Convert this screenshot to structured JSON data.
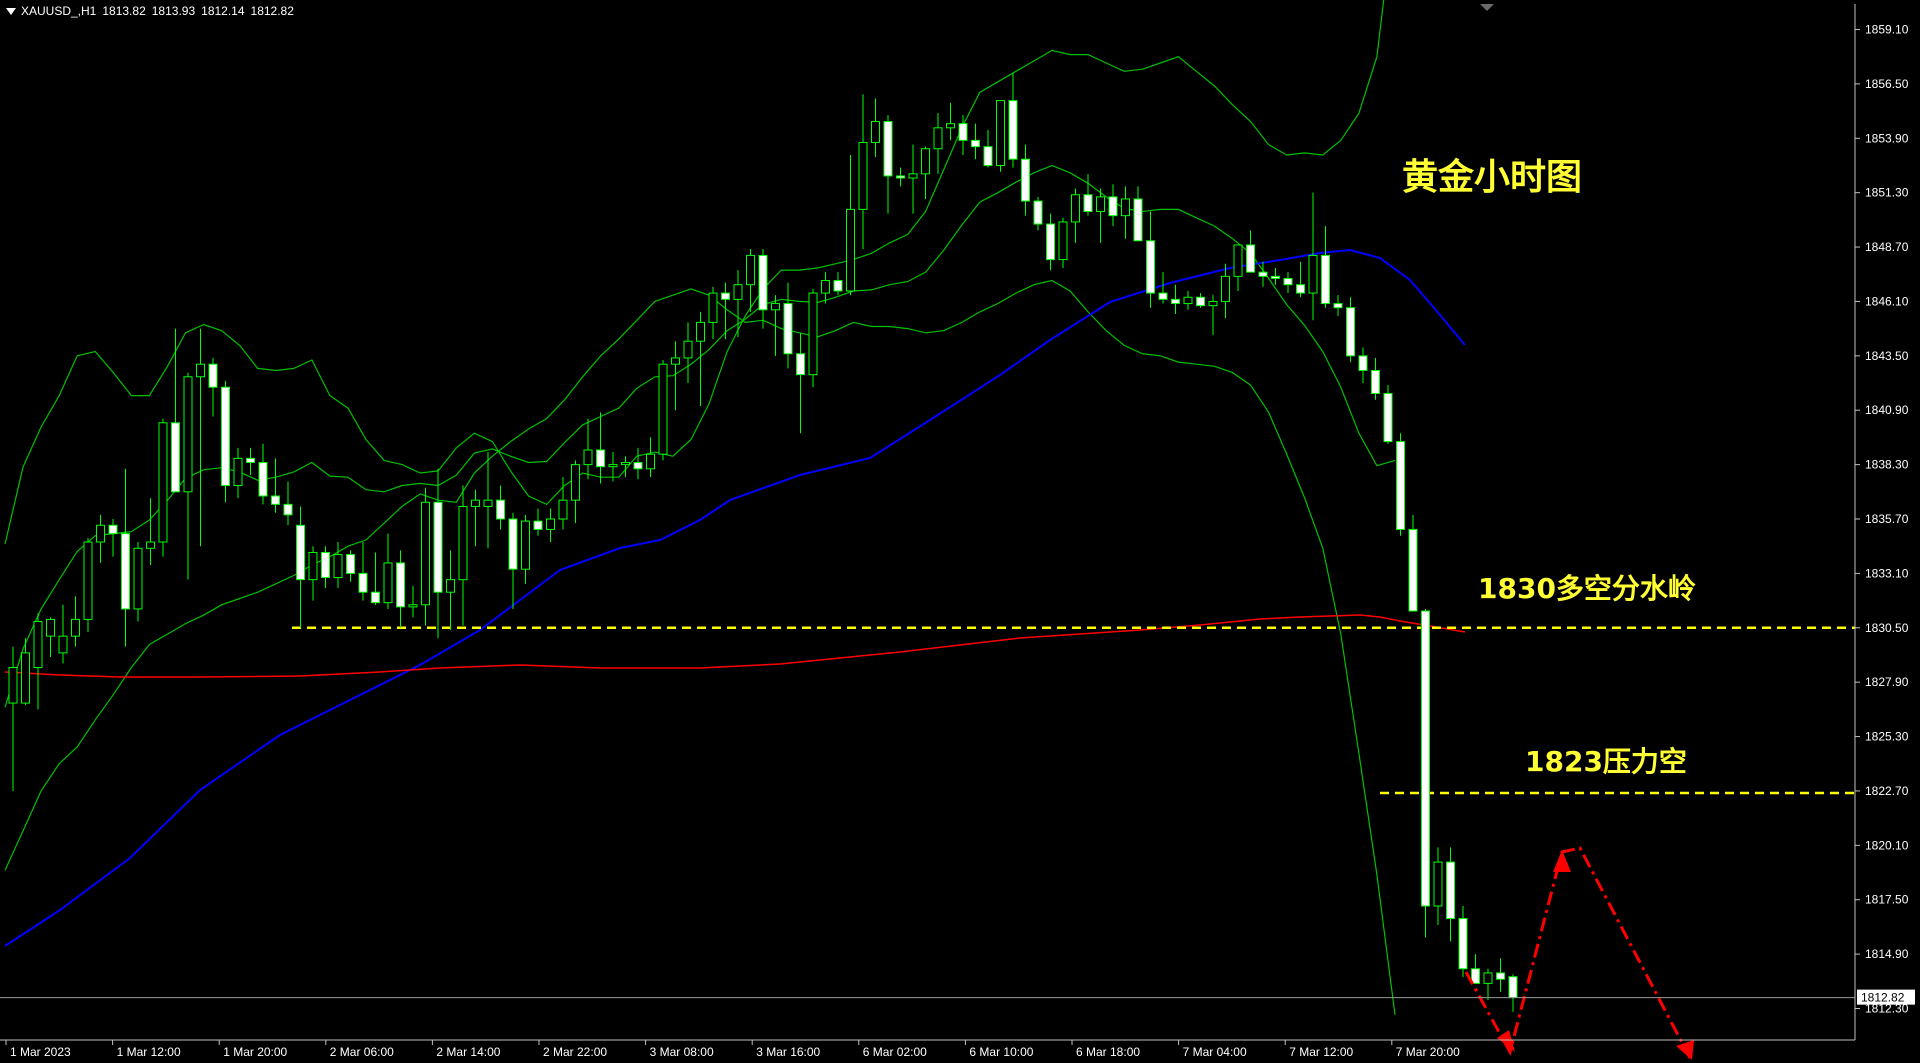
{
  "header": {
    "symbol": "XAUUSD_,H1",
    "open": "1813.82",
    "high": "1813.93",
    "low": "1812.14",
    "close": "1812.82"
  },
  "annotations": {
    "title": "黄金小时图",
    "level_1830_label": "1830多空分水岭",
    "level_1823_label": "1823压力空"
  },
  "colors": {
    "background": "#000000",
    "axis": "#c0c0c0",
    "candle_up": "#000000",
    "candle_down": "#ffffff",
    "wick": "#00ff00",
    "bollinger": "#00c000",
    "ma_blue": "#0000ff",
    "ma_red": "#ff0000",
    "level_line": "#ffff00",
    "projection": "#ff0000"
  },
  "chart_data": {
    "type": "candlestick",
    "price_axis": {
      "ylim": [
        1811.1,
        1860.3
      ],
      "ticks": [
        "1859.10",
        "1856.50",
        "1853.90",
        "1851.30",
        "1848.70",
        "1846.10",
        "1843.50",
        "1840.90",
        "1838.30",
        "1835.70",
        "1833.10",
        "1830.50",
        "1827.90",
        "1825.30",
        "1822.70",
        "1820.10",
        "1817.50",
        "1814.90",
        "1812.30"
      ],
      "current_price": "1812.82"
    },
    "time_axis": {
      "ticks": [
        "1 Mar 2023",
        "1 Mar 12:00",
        "1 Mar 20:00",
        "2 Mar 06:00",
        "2 Mar 14:00",
        "2 Mar 22:00",
        "3 Mar 08:00",
        "3 Mar 16:00",
        "6 Mar 02:00",
        "6 Mar 10:00",
        "6 Mar 18:00",
        "7 Mar 04:00",
        "7 Mar 12:00",
        "7 Mar 20:00"
      ]
    },
    "candles": [
      {
        "o": 1826.9,
        "h": 1829.6,
        "l": 1822.7,
        "c": 1828.6
      },
      {
        "o": 1826.9,
        "h": 1830.0,
        "l": 1826.8,
        "c": 1829.3
      },
      {
        "o": 1828.6,
        "h": 1831.2,
        "l": 1826.6,
        "c": 1830.8
      },
      {
        "o": 1830.1,
        "h": 1831.0,
        "l": 1829.1,
        "c": 1830.9
      },
      {
        "o": 1829.3,
        "h": 1831.6,
        "l": 1828.8,
        "c": 1830.1
      },
      {
        "o": 1830.1,
        "h": 1832.0,
        "l": 1829.6,
        "c": 1830.9
      },
      {
        "o": 1830.9,
        "h": 1834.8,
        "l": 1830.3,
        "c": 1834.6
      },
      {
        "o": 1834.6,
        "h": 1835.9,
        "l": 1833.6,
        "c": 1835.4
      },
      {
        "o": 1835.4,
        "h": 1835.7,
        "l": 1833.9,
        "c": 1835.0
      },
      {
        "o": 1835.0,
        "h": 1838.1,
        "l": 1829.6,
        "c": 1831.4
      },
      {
        "o": 1831.4,
        "h": 1834.6,
        "l": 1830.8,
        "c": 1834.3
      },
      {
        "o": 1834.3,
        "h": 1836.7,
        "l": 1833.5,
        "c": 1834.6
      },
      {
        "o": 1834.6,
        "h": 1840.5,
        "l": 1833.9,
        "c": 1840.3
      },
      {
        "o": 1840.3,
        "h": 1844.8,
        "l": 1840.0,
        "c": 1837.0
      },
      {
        "o": 1837.0,
        "h": 1842.7,
        "l": 1832.8,
        "c": 1842.5
      },
      {
        "o": 1842.5,
        "h": 1844.8,
        "l": 1834.4,
        "c": 1843.1
      },
      {
        "o": 1843.1,
        "h": 1843.4,
        "l": 1840.6,
        "c": 1842.0
      },
      {
        "o": 1842.0,
        "h": 1842.3,
        "l": 1836.5,
        "c": 1837.3
      },
      {
        "o": 1837.3,
        "h": 1839.1,
        "l": 1836.7,
        "c": 1838.6
      },
      {
        "o": 1838.6,
        "h": 1839.1,
        "l": 1837.8,
        "c": 1838.4
      },
      {
        "o": 1838.4,
        "h": 1839.3,
        "l": 1836.4,
        "c": 1836.8
      },
      {
        "o": 1836.8,
        "h": 1838.6,
        "l": 1836.0,
        "c": 1836.4
      },
      {
        "o": 1836.4,
        "h": 1837.5,
        "l": 1835.4,
        "c": 1835.9
      },
      {
        "o": 1835.4,
        "h": 1836.3,
        "l": 1830.5,
        "c": 1832.8
      },
      {
        "o": 1832.8,
        "h": 1834.4,
        "l": 1831.8,
        "c": 1834.1
      },
      {
        "o": 1834.1,
        "h": 1834.4,
        "l": 1832.4,
        "c": 1832.9
      },
      {
        "o": 1832.9,
        "h": 1834.6,
        "l": 1832.4,
        "c": 1834.0
      },
      {
        "o": 1834.0,
        "h": 1834.2,
        "l": 1832.7,
        "c": 1833.1
      },
      {
        "o": 1833.1,
        "h": 1834.6,
        "l": 1831.8,
        "c": 1832.2
      },
      {
        "o": 1832.2,
        "h": 1834.1,
        "l": 1831.6,
        "c": 1831.7
      },
      {
        "o": 1831.7,
        "h": 1835.0,
        "l": 1831.4,
        "c": 1833.6
      },
      {
        "o": 1833.6,
        "h": 1834.2,
        "l": 1830.5,
        "c": 1831.5
      },
      {
        "o": 1831.5,
        "h": 1832.5,
        "l": 1831.0,
        "c": 1831.6
      },
      {
        "o": 1831.6,
        "h": 1837.2,
        "l": 1830.6,
        "c": 1836.5
      },
      {
        "o": 1836.5,
        "h": 1838.1,
        "l": 1830.0,
        "c": 1832.2
      },
      {
        "o": 1832.2,
        "h": 1834.2,
        "l": 1830.4,
        "c": 1832.8
      },
      {
        "o": 1832.8,
        "h": 1837.3,
        "l": 1830.6,
        "c": 1836.3
      },
      {
        "o": 1836.3,
        "h": 1837.1,
        "l": 1834.4,
        "c": 1836.6
      },
      {
        "o": 1836.3,
        "h": 1838.9,
        "l": 1834.3,
        "c": 1836.6
      },
      {
        "o": 1836.6,
        "h": 1837.3,
        "l": 1835.2,
        "c": 1835.7
      },
      {
        "o": 1835.7,
        "h": 1836.0,
        "l": 1831.4,
        "c": 1833.3
      },
      {
        "o": 1833.3,
        "h": 1835.9,
        "l": 1832.6,
        "c": 1835.6
      },
      {
        "o": 1835.6,
        "h": 1836.2,
        "l": 1834.9,
        "c": 1835.2
      },
      {
        "o": 1835.2,
        "h": 1836.2,
        "l": 1834.6,
        "c": 1835.7
      },
      {
        "o": 1835.7,
        "h": 1837.7,
        "l": 1835.2,
        "c": 1836.6
      },
      {
        "o": 1836.6,
        "h": 1838.5,
        "l": 1835.5,
        "c": 1838.3
      },
      {
        "o": 1838.3,
        "h": 1840.5,
        "l": 1837.6,
        "c": 1839.0
      },
      {
        "o": 1839.0,
        "h": 1840.8,
        "l": 1837.4,
        "c": 1838.2
      },
      {
        "o": 1838.2,
        "h": 1838.9,
        "l": 1837.5,
        "c": 1838.3
      },
      {
        "o": 1838.3,
        "h": 1838.7,
        "l": 1837.7,
        "c": 1838.4
      },
      {
        "o": 1838.4,
        "h": 1839.1,
        "l": 1837.6,
        "c": 1838.1
      },
      {
        "o": 1838.1,
        "h": 1839.6,
        "l": 1837.7,
        "c": 1838.8
      },
      {
        "o": 1838.8,
        "h": 1843.3,
        "l": 1838.5,
        "c": 1843.1
      },
      {
        "o": 1843.1,
        "h": 1844.2,
        "l": 1840.9,
        "c": 1843.4
      },
      {
        "o": 1843.4,
        "h": 1845.1,
        "l": 1842.2,
        "c": 1844.2
      },
      {
        "o": 1844.2,
        "h": 1845.6,
        "l": 1841.1,
        "c": 1845.1
      },
      {
        "o": 1845.1,
        "h": 1846.8,
        "l": 1844.3,
        "c": 1846.5
      },
      {
        "o": 1846.5,
        "h": 1847.0,
        "l": 1844.3,
        "c": 1846.2
      },
      {
        "o": 1846.2,
        "h": 1847.6,
        "l": 1844.4,
        "c": 1846.9
      },
      {
        "o": 1846.9,
        "h": 1848.6,
        "l": 1845.6,
        "c": 1848.3
      },
      {
        "o": 1848.3,
        "h": 1848.6,
        "l": 1844.8,
        "c": 1845.7
      },
      {
        "o": 1845.7,
        "h": 1846.4,
        "l": 1843.5,
        "c": 1846.0
      },
      {
        "o": 1846.0,
        "h": 1847.0,
        "l": 1842.9,
        "c": 1843.6
      },
      {
        "o": 1843.6,
        "h": 1844.6,
        "l": 1839.8,
        "c": 1842.6
      },
      {
        "o": 1842.6,
        "h": 1846.7,
        "l": 1842.0,
        "c": 1846.5
      },
      {
        "o": 1846.5,
        "h": 1847.5,
        "l": 1846.0,
        "c": 1847.1
      },
      {
        "o": 1847.1,
        "h": 1847.5,
        "l": 1846.4,
        "c": 1846.6
      },
      {
        "o": 1846.6,
        "h": 1853.1,
        "l": 1846.4,
        "c": 1850.5
      },
      {
        "o": 1850.5,
        "h": 1856.0,
        "l": 1848.6,
        "c": 1853.7
      },
      {
        "o": 1853.7,
        "h": 1855.8,
        "l": 1853.0,
        "c": 1854.7
      },
      {
        "o": 1854.7,
        "h": 1855.0,
        "l": 1850.3,
        "c": 1852.1
      },
      {
        "o": 1852.1,
        "h": 1852.5,
        "l": 1851.6,
        "c": 1852.0
      },
      {
        "o": 1852.0,
        "h": 1853.6,
        "l": 1850.3,
        "c": 1852.2
      },
      {
        "o": 1852.2,
        "h": 1853.5,
        "l": 1851.0,
        "c": 1853.4
      },
      {
        "o": 1853.4,
        "h": 1855.1,
        "l": 1852.2,
        "c": 1854.4
      },
      {
        "o": 1854.4,
        "h": 1855.6,
        "l": 1853.8,
        "c": 1854.6
      },
      {
        "o": 1854.6,
        "h": 1855.0,
        "l": 1853.1,
        "c": 1853.8
      },
      {
        "o": 1853.8,
        "h": 1854.6,
        "l": 1852.9,
        "c": 1853.5
      },
      {
        "o": 1853.5,
        "h": 1854.3,
        "l": 1852.5,
        "c": 1852.6
      },
      {
        "o": 1852.6,
        "h": 1854.7,
        "l": 1852.3,
        "c": 1855.7
      },
      {
        "o": 1855.7,
        "h": 1857.0,
        "l": 1852.5,
        "c": 1852.9
      },
      {
        "o": 1852.9,
        "h": 1853.6,
        "l": 1850.2,
        "c": 1850.9
      },
      {
        "o": 1850.9,
        "h": 1851.1,
        "l": 1849.5,
        "c": 1849.8
      },
      {
        "o": 1849.8,
        "h": 1850.3,
        "l": 1847.6,
        "c": 1848.1
      },
      {
        "o": 1848.1,
        "h": 1850.1,
        "l": 1847.7,
        "c": 1849.9
      },
      {
        "o": 1849.9,
        "h": 1851.5,
        "l": 1848.9,
        "c": 1851.2
      },
      {
        "o": 1851.2,
        "h": 1852.2,
        "l": 1850.2,
        "c": 1850.4
      },
      {
        "o": 1850.4,
        "h": 1851.5,
        "l": 1848.9,
        "c": 1851.1
      },
      {
        "o": 1851.1,
        "h": 1851.7,
        "l": 1849.7,
        "c": 1850.2
      },
      {
        "o": 1850.2,
        "h": 1851.6,
        "l": 1849.1,
        "c": 1851.0
      },
      {
        "o": 1851.0,
        "h": 1851.6,
        "l": 1849.6,
        "c": 1849.0
      },
      {
        "o": 1849.0,
        "h": 1850.4,
        "l": 1845.8,
        "c": 1846.5
      },
      {
        "o": 1846.5,
        "h": 1847.5,
        "l": 1846.0,
        "c": 1846.2
      },
      {
        "o": 1846.2,
        "h": 1846.9,
        "l": 1845.5,
        "c": 1846.0
      },
      {
        "o": 1846.0,
        "h": 1846.6,
        "l": 1845.7,
        "c": 1846.3
      },
      {
        "o": 1846.3,
        "h": 1846.5,
        "l": 1845.8,
        "c": 1845.9
      },
      {
        "o": 1845.9,
        "h": 1846.4,
        "l": 1844.5,
        "c": 1846.1
      },
      {
        "o": 1846.1,
        "h": 1847.9,
        "l": 1845.3,
        "c": 1847.3
      },
      {
        "o": 1847.3,
        "h": 1848.8,
        "l": 1846.6,
        "c": 1848.8
      },
      {
        "o": 1848.8,
        "h": 1849.5,
        "l": 1847.6,
        "c": 1847.5
      },
      {
        "o": 1847.5,
        "h": 1848.0,
        "l": 1846.8,
        "c": 1847.3
      },
      {
        "o": 1847.3,
        "h": 1847.7,
        "l": 1846.9,
        "c": 1847.2
      },
      {
        "o": 1847.2,
        "h": 1847.5,
        "l": 1846.5,
        "c": 1846.9
      },
      {
        "o": 1846.9,
        "h": 1848.0,
        "l": 1846.3,
        "c": 1846.5
      },
      {
        "o": 1846.5,
        "h": 1851.3,
        "l": 1845.2,
        "c": 1848.3
      },
      {
        "o": 1848.3,
        "h": 1849.7,
        "l": 1845.8,
        "c": 1846.0
      },
      {
        "o": 1846.0,
        "h": 1846.4,
        "l": 1845.4,
        "c": 1845.8
      },
      {
        "o": 1845.8,
        "h": 1846.3,
        "l": 1843.2,
        "c": 1843.5
      },
      {
        "o": 1843.5,
        "h": 1843.9,
        "l": 1842.2,
        "c": 1842.8
      },
      {
        "o": 1842.8,
        "h": 1843.4,
        "l": 1841.4,
        "c": 1841.7
      },
      {
        "o": 1841.7,
        "h": 1842.1,
        "l": 1839.3,
        "c": 1839.4
      },
      {
        "o": 1839.4,
        "h": 1839.8,
        "l": 1834.9,
        "c": 1835.2
      },
      {
        "o": 1835.2,
        "h": 1835.9,
        "l": 1831.3,
        "c": 1831.3
      },
      {
        "o": 1831.3,
        "h": 1831.4,
        "l": 1815.7,
        "c": 1817.2
      },
      {
        "o": 1817.2,
        "h": 1820.0,
        "l": 1816.3,
        "c": 1819.3
      },
      {
        "o": 1819.3,
        "h": 1820.0,
        "l": 1815.5,
        "c": 1816.6
      },
      {
        "o": 1816.6,
        "h": 1817.2,
        "l": 1813.8,
        "c": 1814.2
      },
      {
        "o": 1814.2,
        "h": 1814.9,
        "l": 1813.6,
        "c": 1813.5
      },
      {
        "o": 1813.5,
        "h": 1814.2,
        "l": 1812.7,
        "c": 1814.0
      },
      {
        "o": 1814.0,
        "h": 1814.7,
        "l": 1813.1,
        "c": 1813.7
      },
      {
        "o": 1813.82,
        "h": 1813.93,
        "l": 1812.14,
        "c": 1812.82
      }
    ],
    "bb_upper": [
      1834.5,
      1838.2,
      1840.1,
      1841.6,
      1843.5,
      1843.7,
      1842.7,
      1841.6,
      1841.6,
      1843.0,
      1844.6,
      1845.0,
      1844.7,
      1844.0,
      1842.9,
      1842.8,
      1842.9,
      1843.3,
      1841.6,
      1841.0,
      1839.5,
      1838.5,
      1838.3,
      1837.9,
      1838.0,
      1839.1,
      1839.8,
      1839.4,
      1838.0,
      1836.8,
      1836.4,
      1837.3,
      1837.9,
      1837.7,
      1837.7,
      1838.7,
      1838.9,
      1838.7,
      1839.5,
      1841.2,
      1843.7,
      1845.4,
      1846.7,
      1847.6,
      1847.6,
      1847.7,
      1847.9,
      1848.1,
      1848.4,
      1848.9,
      1849.3,
      1850.4,
      1852.4,
      1854.4,
      1856.1,
      1856.6,
      1857.1,
      1857.6,
      1858.1,
      1857.9,
      1857.9,
      1857.5,
      1857.1,
      1857.2,
      1857.5,
      1857.8,
      1857.1,
      1856.4,
      1855.5,
      1854.7,
      1853.6,
      1853.1,
      1853.2,
      1853.1,
      1853.8,
      1855.1,
      1857.8,
      1865.0
    ],
    "bb_lower": [
      1818.9,
      1820.8,
      1822.7,
      1824.0,
      1824.8,
      1826.1,
      1827.3,
      1828.6,
      1829.7,
      1830.2,
      1830.7,
      1831.1,
      1831.6,
      1831.9,
      1832.2,
      1832.6,
      1833.0,
      1833.5,
      1833.9,
      1834.4,
      1834.7,
      1835.5,
      1836.3,
      1836.9,
      1836.6,
      1836.5,
      1837.9,
      1838.7,
      1839.4,
      1840.0,
      1840.5,
      1841.4,
      1842.5,
      1843.5,
      1844.3,
      1845.2,
      1846.1,
      1846.4,
      1846.7,
      1846.4,
      1845.7,
      1845.1,
      1845.2,
      1844.8,
      1844.6,
      1844.4,
      1844.7,
      1845.1,
      1844.9,
      1844.9,
      1844.8,
      1844.6,
      1844.7,
      1845.1,
      1845.6,
      1846.0,
      1846.5,
      1846.9,
      1847.1,
      1846.6,
      1845.6,
      1844.7,
      1844.0,
      1843.6,
      1843.5,
      1843.2,
      1843.1,
      1843.0,
      1842.7,
      1842.1,
      1840.8,
      1838.8,
      1836.7,
      1834.3,
      1830.2,
      1824.5,
      1818.7,
      1812.0
    ]
  }
}
